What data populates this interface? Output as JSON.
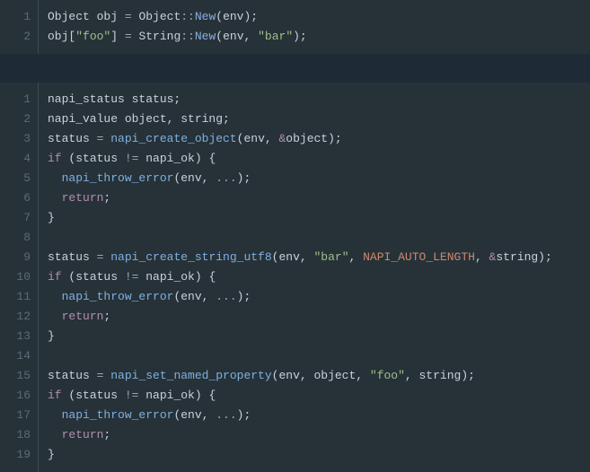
{
  "blocks": [
    {
      "lines": [
        {
          "n": "1",
          "tokens": [
            {
              "t": "Object",
              "c": "tk-type"
            },
            {
              "t": " obj ",
              "c": "tk-ident"
            },
            {
              "t": "=",
              "c": "tk-op"
            },
            {
              "t": " Object",
              "c": "tk-type"
            },
            {
              "t": "::",
              "c": "tk-op"
            },
            {
              "t": "New",
              "c": "tk-func"
            },
            {
              "t": "(",
              "c": "tk-punc"
            },
            {
              "t": "env",
              "c": "tk-ident"
            },
            {
              "t": ");",
              "c": "tk-punc"
            }
          ]
        },
        {
          "n": "2",
          "tokens": [
            {
              "t": "obj[",
              "c": "tk-ident"
            },
            {
              "t": "\"foo\"",
              "c": "tk-str"
            },
            {
              "t": "] ",
              "c": "tk-ident"
            },
            {
              "t": "=",
              "c": "tk-op"
            },
            {
              "t": " String",
              "c": "tk-type"
            },
            {
              "t": "::",
              "c": "tk-op"
            },
            {
              "t": "New",
              "c": "tk-func"
            },
            {
              "t": "(",
              "c": "tk-punc"
            },
            {
              "t": "env, ",
              "c": "tk-ident"
            },
            {
              "t": "\"bar\"",
              "c": "tk-str"
            },
            {
              "t": ");",
              "c": "tk-punc"
            }
          ]
        }
      ]
    },
    {
      "lines": [
        {
          "n": "1",
          "tokens": [
            {
              "t": "napi_status status;",
              "c": "tk-ident"
            }
          ]
        },
        {
          "n": "2",
          "tokens": [
            {
              "t": "napi_value object, string;",
              "c": "tk-ident"
            }
          ]
        },
        {
          "n": "3",
          "tokens": [
            {
              "t": "status ",
              "c": "tk-ident"
            },
            {
              "t": "=",
              "c": "tk-op"
            },
            {
              "t": " ",
              "c": ""
            },
            {
              "t": "napi_create_object",
              "c": "tk-call"
            },
            {
              "t": "(env, ",
              "c": "tk-ident"
            },
            {
              "t": "&",
              "c": "tk-addr"
            },
            {
              "t": "object);",
              "c": "tk-ident"
            }
          ]
        },
        {
          "n": "4",
          "tokens": [
            {
              "t": "if",
              "c": "tk-kw"
            },
            {
              "t": " (status ",
              "c": "tk-ident"
            },
            {
              "t": "!=",
              "c": "tk-op"
            },
            {
              "t": " napi_ok) {",
              "c": "tk-ident"
            }
          ]
        },
        {
          "n": "5",
          "tokens": [
            {
              "t": "  ",
              "c": ""
            },
            {
              "t": "napi_throw_error",
              "c": "tk-call"
            },
            {
              "t": "(env, ",
              "c": "tk-ident"
            },
            {
              "t": "...",
              "c": "tk-dots"
            },
            {
              "t": ");",
              "c": "tk-punc"
            }
          ]
        },
        {
          "n": "6",
          "tokens": [
            {
              "t": "  ",
              "c": ""
            },
            {
              "t": "return",
              "c": "tk-kwflow"
            },
            {
              "t": ";",
              "c": "tk-punc"
            }
          ]
        },
        {
          "n": "7",
          "tokens": [
            {
              "t": "}",
              "c": "tk-punc"
            }
          ]
        },
        {
          "n": "8",
          "tokens": [
            {
              "t": " ",
              "c": ""
            }
          ]
        },
        {
          "n": "9",
          "tokens": [
            {
              "t": "status ",
              "c": "tk-ident"
            },
            {
              "t": "=",
              "c": "tk-op"
            },
            {
              "t": " ",
              "c": ""
            },
            {
              "t": "napi_create_string_utf8",
              "c": "tk-call"
            },
            {
              "t": "(env, ",
              "c": "tk-ident"
            },
            {
              "t": "\"bar\"",
              "c": "tk-str"
            },
            {
              "t": ", ",
              "c": "tk-ident"
            },
            {
              "t": "NAPI_AUTO_LENGTH",
              "c": "tk-const"
            },
            {
              "t": ", ",
              "c": "tk-ident"
            },
            {
              "t": "&",
              "c": "tk-addr"
            },
            {
              "t": "string);",
              "c": "tk-ident"
            }
          ]
        },
        {
          "n": "10",
          "tokens": [
            {
              "t": "if",
              "c": "tk-kw"
            },
            {
              "t": " (status ",
              "c": "tk-ident"
            },
            {
              "t": "!=",
              "c": "tk-op"
            },
            {
              "t": " napi_ok) {",
              "c": "tk-ident"
            }
          ]
        },
        {
          "n": "11",
          "tokens": [
            {
              "t": "  ",
              "c": ""
            },
            {
              "t": "napi_throw_error",
              "c": "tk-call"
            },
            {
              "t": "(env, ",
              "c": "tk-ident"
            },
            {
              "t": "...",
              "c": "tk-dots"
            },
            {
              "t": ");",
              "c": "tk-punc"
            }
          ]
        },
        {
          "n": "12",
          "tokens": [
            {
              "t": "  ",
              "c": ""
            },
            {
              "t": "return",
              "c": "tk-kwflow"
            },
            {
              "t": ";",
              "c": "tk-punc"
            }
          ]
        },
        {
          "n": "13",
          "tokens": [
            {
              "t": "}",
              "c": "tk-punc"
            }
          ]
        },
        {
          "n": "14",
          "tokens": [
            {
              "t": " ",
              "c": ""
            }
          ]
        },
        {
          "n": "15",
          "tokens": [
            {
              "t": "status ",
              "c": "tk-ident"
            },
            {
              "t": "=",
              "c": "tk-op"
            },
            {
              "t": " ",
              "c": ""
            },
            {
              "t": "napi_set_named_property",
              "c": "tk-call"
            },
            {
              "t": "(env, object, ",
              "c": "tk-ident"
            },
            {
              "t": "\"foo\"",
              "c": "tk-str"
            },
            {
              "t": ", string);",
              "c": "tk-ident"
            }
          ]
        },
        {
          "n": "16",
          "tokens": [
            {
              "t": "if",
              "c": "tk-kw"
            },
            {
              "t": " (status ",
              "c": "tk-ident"
            },
            {
              "t": "!=",
              "c": "tk-op"
            },
            {
              "t": " napi_ok) {",
              "c": "tk-ident"
            }
          ]
        },
        {
          "n": "17",
          "tokens": [
            {
              "t": "  ",
              "c": ""
            },
            {
              "t": "napi_throw_error",
              "c": "tk-call"
            },
            {
              "t": "(env, ",
              "c": "tk-ident"
            },
            {
              "t": "...",
              "c": "tk-dots"
            },
            {
              "t": ");",
              "c": "tk-punc"
            }
          ]
        },
        {
          "n": "18",
          "tokens": [
            {
              "t": "  ",
              "c": ""
            },
            {
              "t": "return",
              "c": "tk-kwflow"
            },
            {
              "t": ";",
              "c": "tk-punc"
            }
          ]
        },
        {
          "n": "19",
          "tokens": [
            {
              "t": "}",
              "c": "tk-punc"
            }
          ]
        }
      ]
    }
  ]
}
